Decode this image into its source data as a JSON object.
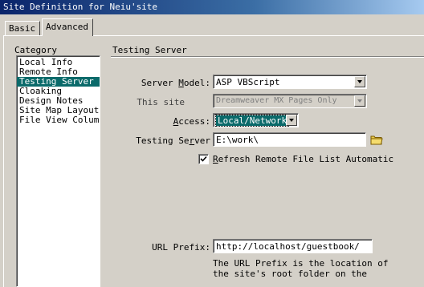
{
  "window": {
    "title": "Site Definition for Neiu'site"
  },
  "tabs": [
    {
      "label": "Basic",
      "active": false
    },
    {
      "label": "Advanced",
      "active": true
    }
  ],
  "category": {
    "label": "Category",
    "items": [
      {
        "label": "Local Info"
      },
      {
        "label": "Remote Info"
      },
      {
        "label": "Testing Server",
        "selected": true
      },
      {
        "label": "Cloaking"
      },
      {
        "label": "Design Notes"
      },
      {
        "label": "Site Map Layout"
      },
      {
        "label": "File View Columns"
      }
    ]
  },
  "section": {
    "title": "Testing Server"
  },
  "form": {
    "server_model": {
      "label_pre": "Server ",
      "label_accel": "M",
      "label_post": "odel:",
      "value": "ASP VBScript"
    },
    "this_site": {
      "label": "This site",
      "value": "Dreamweaver MX Pages Only"
    },
    "access": {
      "label_accel": "A",
      "label_post": "ccess:",
      "value": "Local/Network"
    },
    "testing_server": {
      "label_pre": "Testing Se",
      "label_accel": "r",
      "label_post": "ver",
      "value": "E:\\work\\"
    },
    "refresh": {
      "label_accel": "R",
      "label_post": "efresh Remote File List Automatic",
      "checked": true
    },
    "url_prefix": {
      "label": "URL Prefix:",
      "value": "http://localhost/guestbook/"
    },
    "help_text": {
      "line1": "The URL Prefix is the location of",
      "line2": "the site's root folder on the"
    }
  },
  "colors": {
    "selection": "#0a6a6a",
    "dialog_bg": "#d4d0c8",
    "titlebar": "#0a246a"
  },
  "icons": {
    "folder": "folder-icon",
    "dropdown": "chevron-down-icon",
    "checkmark": "checkmark-icon"
  }
}
